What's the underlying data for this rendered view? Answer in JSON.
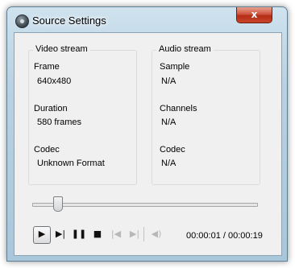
{
  "window": {
    "title": "Source Settings",
    "close_glyph": "x"
  },
  "video": {
    "group_title": "Video stream",
    "frame_label": "Frame",
    "frame_value": "640x480",
    "duration_label": "Duration",
    "duration_value": "580 frames",
    "codec_label": "Codec",
    "codec_value": "Unknown Format"
  },
  "audio": {
    "group_title": "Audio stream",
    "sample_label": "Sample",
    "sample_value": "N/A",
    "channels_label": "Channels",
    "channels_value": "N/A",
    "codec_label": "Codec",
    "codec_value": "N/A"
  },
  "seek": {
    "position_fraction": 0.11
  },
  "controls": {
    "play_icon": "▶",
    "step_forward_icon": "▶|",
    "pause_icon": "❚❚",
    "stop_icon": "■",
    "prev_icon": "|◀",
    "next_icon": "▶|",
    "volume_icon": "◀)"
  },
  "time": {
    "readout": "00:00:01 / 00:00:19"
  },
  "colors": {
    "frame_blue": "#b9d2e3",
    "close_red": "#c7452a",
    "client_bg": "#f0f0f0"
  }
}
